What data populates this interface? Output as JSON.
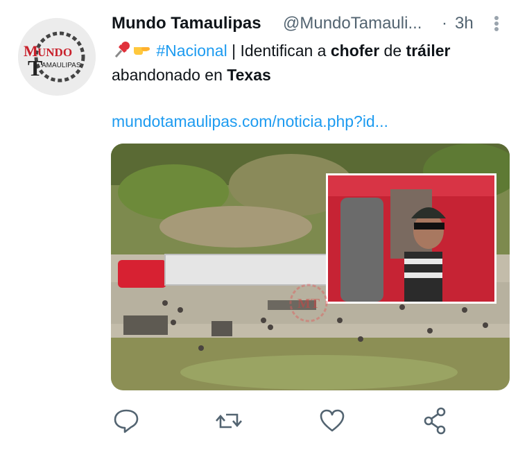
{
  "tweet": {
    "author_name": "Mundo Tamaulipas",
    "author_handle": "@MundoTamauli...",
    "separator": "·",
    "timestamp": "3h",
    "text": {
      "hashtag": "#Nacional",
      "t1": " | Identifican a ",
      "b1": "chofer",
      "t2": " de ",
      "b2": "tráiler",
      "t3": "abandonado en ",
      "b3": "Texas"
    },
    "link": "mundotamaulipas.com/noticia.php?id..."
  },
  "avatar": {
    "logo_word": "MUNDO",
    "logo_letter": "T",
    "logo_sub": "AMAULIPAS",
    "logo_color": "#c8202b"
  },
  "media": {
    "watermark": "MT"
  },
  "actions": [
    "reply-icon",
    "retweet-icon",
    "like-icon",
    "share-icon"
  ],
  "colors": {
    "link": "#1d9bf0",
    "secondary": "#536471",
    "truck_red": "#d72132"
  }
}
